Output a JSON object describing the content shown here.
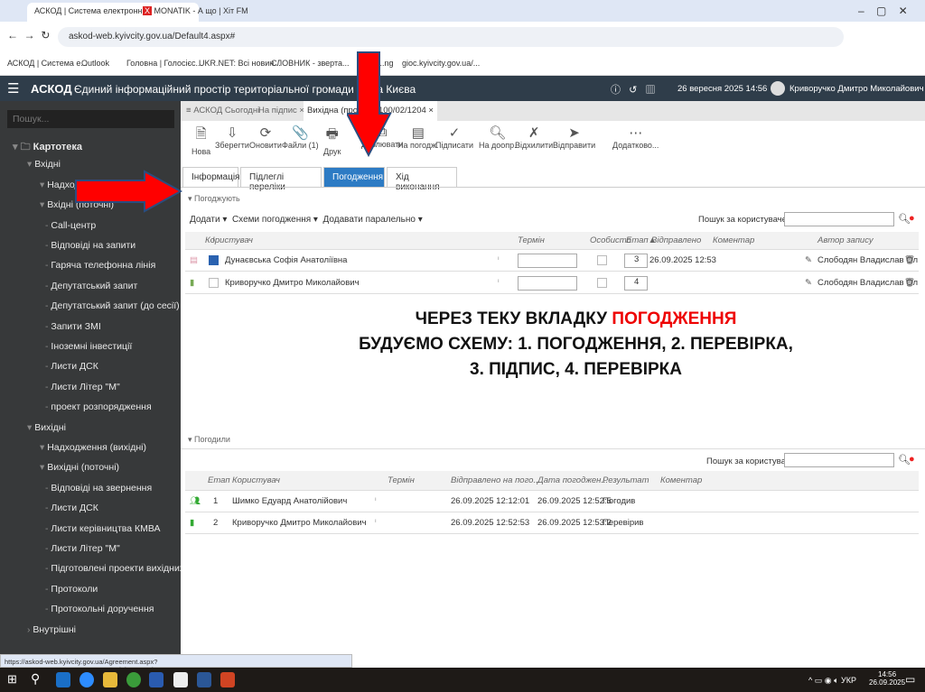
{
  "browser": {
    "tabs": [
      {
        "label": "АСКОД | Система електронн"
      },
      {
        "label": "MONATIK - А що | Хіт FM"
      }
    ],
    "url": "askod-web.kyivcity.gov.ua/Default4.aspx#",
    "bookmarks": [
      "АСКОД | Система е...",
      "Outlook",
      "Головна | Голосієс...",
      "UKR.NET: Всі новин...",
      "СЛОВНИК - зверта...",
      "...ng",
      "gioc.kyivcity.gov.ua/..."
    ]
  },
  "header": {
    "app": "АСКОД",
    "title": "Єдиний інформаційний простір територіальної громади міста Києва",
    "date": "26 вересня 2025 14:56",
    "user": "Криворучко Дмитро Миколайович"
  },
  "sidebar": {
    "search_placeholder": "Пошук...",
    "items": [
      "Картотека",
      "Вхідні",
      "Надходження",
      "Вхідні (поточні)",
      "Call-центр",
      "Відповіді на запити",
      "Гаряча телефонна лінія",
      "Депутатський запит",
      "Депутатський запит (до сесії)",
      "Запити ЗМІ",
      "Іноземні інвестиції",
      "Листи ДСК",
      "Листи Літер \"М\"",
      "проект розпорядження",
      "Вихідні",
      "Надходження (вихідні)",
      "Вихідні (поточні)",
      "Відповіді на звернення",
      "Листи ДСК",
      "Листи керівництва КМВА",
      "Листи Літер \"М\"",
      "Підготовлені проекти вихідних",
      "Протоколи",
      "Протокольні доручення",
      "Внутрішні"
    ]
  },
  "doc_tabs": [
    "АСКОД Сьогодні",
    "На підпис",
    "Вихідна (проект) -100/02/1204"
  ],
  "toolbar": [
    "Нова",
    "Зберегти",
    "Оновити",
    "Файли (1)",
    "Друк",
    "Дублювати",
    "На погодж.",
    "Підписати",
    "На доопр.",
    "Відхилити",
    "Відправити",
    "Додатково..."
  ],
  "panel_tabs": [
    "Інформація",
    "Підлеглі переліки",
    "Погодження",
    "Хід виконання"
  ],
  "approving": {
    "title": "Погоджують",
    "actions": [
      "Додати",
      "Схеми погодження",
      "Додавати паралельно"
    ],
    "search_label": "Пошук за користувачем:",
    "columns": [
      "!",
      "Користувач",
      "Термін",
      "Особисто",
      "Етап▲",
      "Відправлено",
      "Коментар",
      "Автор запису"
    ],
    "rows": [
      {
        "user": "Дунаєвська Софія Анатоліївна",
        "stage": "3",
        "sent": "26.09.2025 12:53",
        "author": "Слободян Владислав Ол"
      },
      {
        "user": "Криворучко Дмитро Миколайович",
        "stage": "4",
        "sent": "",
        "author": "Слободян Владислав Ол"
      }
    ]
  },
  "approved": {
    "title": "Погодили",
    "search_label": "Пошук за користувачем:",
    "columns": [
      "Етап",
      "Користувач",
      "Термін",
      "Відправлено на пого...",
      "Дата погоджен...",
      "Результат",
      "Коментар"
    ],
    "rows": [
      {
        "stage": "1",
        "user": "Шимко Едуард Анатолійович",
        "sent": "26.09.2025 12:12:01",
        "date": "26.09.2025 12:52:5",
        "result": "Погодив"
      },
      {
        "stage": "2",
        "user": "Криворучко Дмитро Миколайович",
        "sent": "26.09.2025 12:52:53",
        "date": "26.09.2025 12:53:2",
        "result": "Перевірив"
      }
    ]
  },
  "note": {
    "line1a": "ЧЕРЕЗ ТЕКУ ВКЛАДКУ ",
    "line1b": "ПОГОДЖЕННЯ",
    "line2": "БУДУЄМО СХЕМУ: 1. ПОГОДЖЕННЯ, 2. ПЕРЕВІРКА,",
    "line3": "3. ПІДПИС, 4. ПЕРЕВІРКА"
  },
  "status_url": "https://askod-web.kyivcity.gov.ua/Agreement.aspx?counter=2675995&type=MyRoomOnSight103&token=638944850680000000#",
  "taskbar": {
    "lang": "УКР",
    "time": "14:56",
    "date": "26.09.2025"
  },
  "colors": {
    "accent": "#2d7bc4",
    "arrow": "#ff0000",
    "header": "#2f3d4a"
  }
}
